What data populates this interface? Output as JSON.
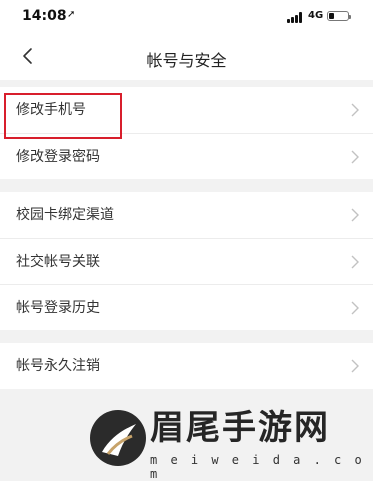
{
  "status_bar": {
    "time": "14:08",
    "network": "4G",
    "location_arrow": "location-arrow-icon",
    "battery_level": 0.25
  },
  "nav": {
    "title": "帐号与安全",
    "back_icon": "chevron-left-icon"
  },
  "groups": [
    {
      "items": [
        {
          "label": "修改手机号",
          "highlighted": true
        },
        {
          "label": "修改登录密码"
        }
      ]
    },
    {
      "items": [
        {
          "label": "校园卡绑定渠道"
        },
        {
          "label": "社交帐号关联"
        },
        {
          "label": "帐号登录历史"
        }
      ]
    },
    {
      "items": [
        {
          "label": "帐号永久注销"
        }
      ]
    }
  ],
  "colors": {
    "highlight_border": "#d81e2c",
    "background": "#f2f2f2"
  },
  "watermark": {
    "title": "眉尾手游网",
    "url": "m e i w e i d a . c o m"
  }
}
